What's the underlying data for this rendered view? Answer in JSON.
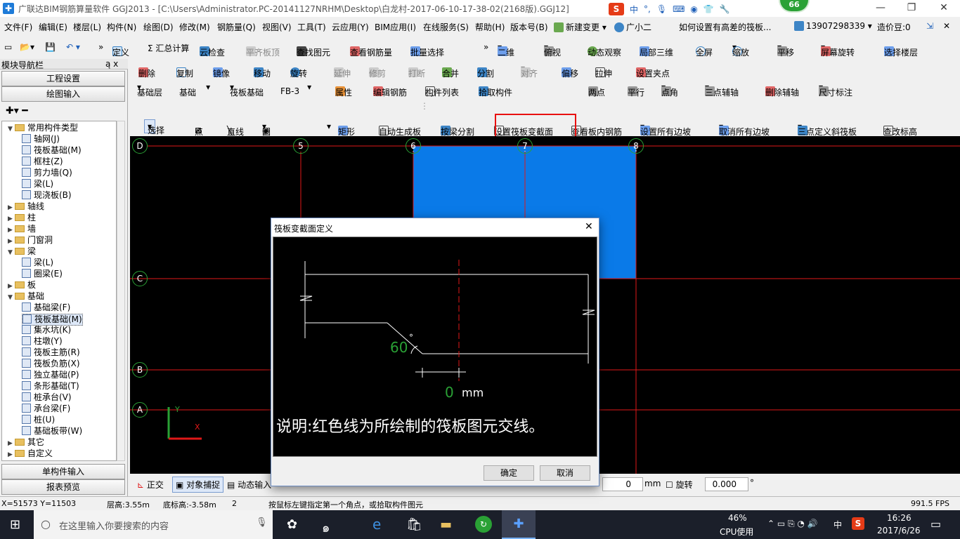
{
  "window": {
    "title": "广联达BIM钢筋算量软件 GGJ2013 - [C:\\Users\\Administrator.PC-20141127NRHM\\Desktop\\白龙村-2017-06-10-17-38-02(2168版).GGJ12]",
    "badge": "66",
    "ime_icons": [
      "S",
      "中",
      "°,",
      "mic-icon",
      "keyboard-icon",
      "skin-icon",
      "shirt-icon",
      "tools-icon"
    ],
    "minimize": "—",
    "restore": "❐",
    "close": "✕"
  },
  "menu": {
    "items": [
      "文件(F)",
      "编辑(E)",
      "楼层(L)",
      "构件(N)",
      "绘图(D)",
      "修改(M)",
      "钢筋量(Q)",
      "视图(V)",
      "工具(T)",
      "云应用(Y)",
      "BIM应用(I)",
      "在线服务(S)",
      "帮助(H)",
      "版本号(B)"
    ],
    "new_change": "新建变更",
    "assistant": "广小二",
    "question": "如何设置有高差的筏板...",
    "phone": "13907298339",
    "beans": "造价豆:0"
  },
  "toolbar1": {
    "items": [
      "定义",
      "Σ 汇总计算",
      "云检查",
      "平齐板顶",
      "查找图元",
      "查看钢筋量",
      "批量选择",
      "二维",
      "俯视",
      "动态观察",
      "局部三维",
      "全屏",
      "缩放",
      "平移",
      "屏幕旋转",
      "选择楼层"
    ]
  },
  "toolbar2": {
    "items": [
      "删除",
      "复制",
      "镜像",
      "移动",
      "旋转",
      "延伸",
      "修剪",
      "打断",
      "合并",
      "分割",
      "对齐",
      "偏移",
      "拉伸",
      "设置夹点"
    ]
  },
  "toolbar3": {
    "floor": "基础层",
    "category": "基础",
    "type": "筏板基础",
    "member": "FB-3",
    "items": [
      "属性",
      "编辑钢筋",
      "构件列表",
      "拾取构件"
    ],
    "aux_items": [
      "两点",
      "平行",
      "点角",
      "三点辅轴",
      "删除辅轴",
      "尺寸标注"
    ]
  },
  "toolbar4": {
    "items": [
      "选择",
      "点",
      "直线",
      "圆",
      "矩形",
      "自动生成板",
      "按梁分割",
      "设置筏板变截面",
      "查看板内钢筋",
      "设置所有边坡",
      "取消所有边坡",
      "三点定义斜筏板",
      "查改标高"
    ]
  },
  "nav": {
    "title": "模块导航栏",
    "pin": "ą x",
    "btn_engineering": "工程设置",
    "btn_drawing": "绘图输入",
    "btn_single": "单构件输入",
    "btn_report": "报表预览",
    "tree": [
      {
        "label": "常用构件类型",
        "level": 0,
        "exp": "▼",
        "folder": true
      },
      {
        "label": "轴网(J)",
        "level": 1
      },
      {
        "label": "筏板基础(M)",
        "level": 1
      },
      {
        "label": "框柱(Z)",
        "level": 1
      },
      {
        "label": "剪力墙(Q)",
        "level": 1
      },
      {
        "label": "梁(L)",
        "level": 1
      },
      {
        "label": "现浇板(B)",
        "level": 1
      },
      {
        "label": "轴线",
        "level": 0,
        "exp": "▶",
        "folder": true
      },
      {
        "label": "柱",
        "level": 0,
        "exp": "▶",
        "folder": true
      },
      {
        "label": "墙",
        "level": 0,
        "exp": "▶",
        "folder": true
      },
      {
        "label": "门窗洞",
        "level": 0,
        "exp": "▶",
        "folder": true
      },
      {
        "label": "梁",
        "level": 0,
        "exp": "▼",
        "folder": true
      },
      {
        "label": "梁(L)",
        "level": 1
      },
      {
        "label": "圈梁(E)",
        "level": 1
      },
      {
        "label": "板",
        "level": 0,
        "exp": "▶",
        "folder": true
      },
      {
        "label": "基础",
        "level": 0,
        "exp": "▼",
        "folder": true
      },
      {
        "label": "基础梁(F)",
        "level": 1
      },
      {
        "label": "筏板基础(M)",
        "level": 1,
        "selected": true
      },
      {
        "label": "集水坑(K)",
        "level": 1
      },
      {
        "label": "柱墩(Y)",
        "level": 1
      },
      {
        "label": "筏板主筋(R)",
        "level": 1
      },
      {
        "label": "筏板负筋(X)",
        "level": 1
      },
      {
        "label": "独立基础(P)",
        "level": 1
      },
      {
        "label": "条形基础(T)",
        "level": 1
      },
      {
        "label": "桩承台(V)",
        "level": 1
      },
      {
        "label": "承台梁(F)",
        "level": 1
      },
      {
        "label": "桩(U)",
        "level": 1
      },
      {
        "label": "基础板带(W)",
        "level": 1
      },
      {
        "label": "其它",
        "level": 0,
        "exp": "▶",
        "folder": true
      },
      {
        "label": "自定义",
        "level": 0,
        "exp": "▶",
        "folder": true
      }
    ]
  },
  "canvas": {
    "axes_top": [
      "D",
      "5",
      "6",
      "7",
      "8"
    ],
    "axes_left": [
      "C",
      "B",
      "A"
    ],
    "ucs_y": "Y",
    "ucs_x": "X"
  },
  "bottomrow": {
    "ortho": "正交",
    "snap": "对象捕捉",
    "dynamic": "动态输入",
    "offset_value": "0",
    "unit": "mm",
    "rotate": "旋转",
    "rotate_value": "0.000",
    "degree": "°"
  },
  "status": {
    "coords": "X=51573 Y=11503",
    "floor_height": "层高:3.55m",
    "bottom_elev": "底标高:-3.58m",
    "num": "2",
    "hint": "按鼠标左键指定第一个角点，或拾取构件图元",
    "fps": "991.5 FPS"
  },
  "dialog": {
    "title": "筏板变截面定义",
    "close": "✕",
    "angle": "60",
    "degree": "°",
    "offset": "0",
    "unit": "mm",
    "note": "说明:红色线为所绘制的筏板图元交线。",
    "ok": "确定",
    "cancel": "取消"
  },
  "taskbar": {
    "search_placeholder": "在这里输入你要搜索的内容",
    "cpu_pct": "46%",
    "cpu_label": "CPU使用",
    "ime": "中",
    "time": "16:26",
    "date": "2017/6/26"
  },
  "colors": {
    "slab_blue": "#0a7ae8",
    "axis_red": "#e01818",
    "axis_green": "#2aa135",
    "highlight_red": "#e81010"
  }
}
